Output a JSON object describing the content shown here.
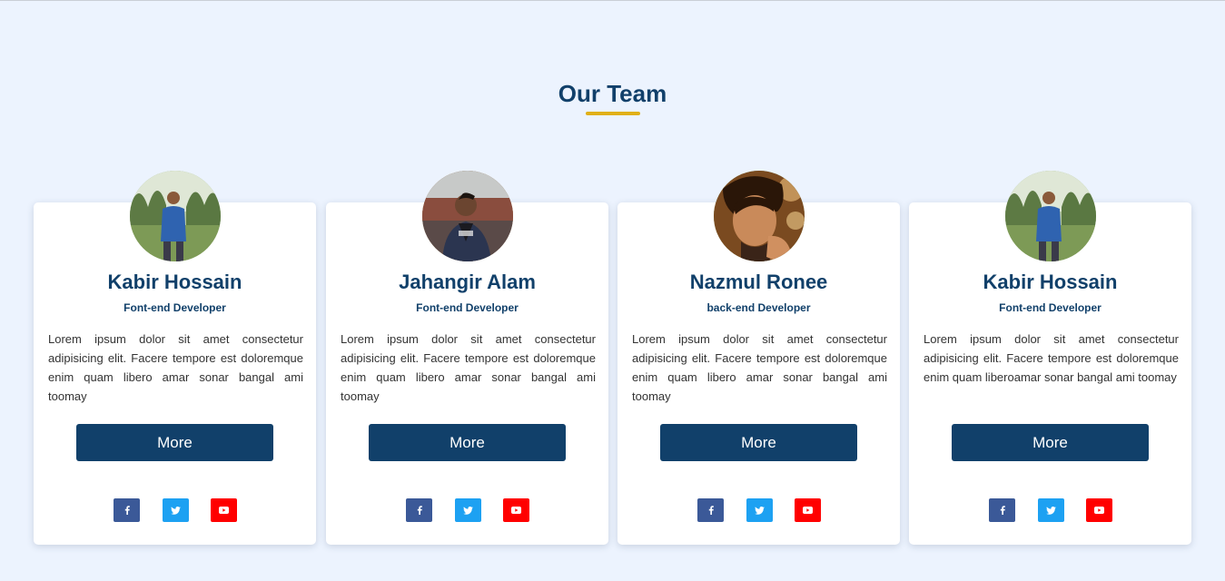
{
  "section": {
    "title": "Our Team",
    "accent_color": "#e0b018",
    "title_color": "#11406a",
    "background": "#ecf3fe"
  },
  "members": [
    {
      "name": "Kabir Hossain",
      "role": "Font-end Developer",
      "description": "Lorem ipsum dolor sit amet consectetur adipisicing elit. Facere tempore est doloremque enim quam libero amar sonar bangal ami toomay",
      "button_label": "More",
      "avatar": "photo-man-blue-shirt-field"
    },
    {
      "name": "Jahangir Alam",
      "role": "Font-end Developer",
      "description": "Lorem ipsum dolor sit amet consectetur adipisicing elit. Facere tempore est doloremque enim quam libero amar sonar bangal ami toomay",
      "button_label": "More",
      "avatar": "photo-man-dark-jacket"
    },
    {
      "name": "Nazmul Ronee",
      "role": "back-end Developer",
      "description": "Lorem ipsum dolor sit amet consectetur adipisicing elit. Facere tempore est doloremque enim quam libero amar sonar bangal ami toomay",
      "button_label": "More",
      "avatar": "photo-man-closeup-warm"
    },
    {
      "name": "Kabir Hossain",
      "role": "Font-end Developer",
      "description": "Lorem ipsum dolor sit amet consectetur adipisicing elit. Facere tempore est doloremque enim quam liberoamar sonar bangal ami toomay",
      "button_label": "More",
      "avatar": "photo-man-blue-shirt-field"
    }
  ],
  "social_icons": [
    {
      "name": "facebook-icon",
      "color": "#3b5998"
    },
    {
      "name": "twitter-icon",
      "color": "#1da1f2"
    },
    {
      "name": "youtube-icon",
      "color": "#ff0000"
    }
  ],
  "button_color": "#11406a"
}
